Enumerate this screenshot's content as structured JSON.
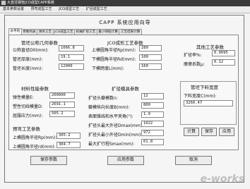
{
  "window": {
    "title": "大直径钢管JCO成型CAPP系统"
  },
  "menu": [
    "基本参数设置",
    "预弯成型工艺",
    "JCO成型工艺",
    "扩径成型工艺"
  ],
  "panel_title": "CAPP 系统应用向导",
  "tabs": [
    "水平的",
    "参数列表",
    "预弯工艺",
    "JCO成型工艺",
    "机械扩径工艺",
    "最少缺陷计算",
    "工艺结果计算"
  ],
  "nominal": {
    "heading": "管坯公称几何参数",
    "rows": [
      {
        "label": "公称直径D0(mm):",
        "value": "1066.8"
      },
      {
        "label": "管坯厚度(mm):",
        "value": "19.1"
      },
      {
        "label": "管坯长度(mm):",
        "value": "12000"
      }
    ]
  },
  "jco": {
    "heading": "JCO成形工艺参数",
    "rows": [
      {
        "label": "上模圆角半径Rp(mm):",
        "value": "280"
      },
      {
        "label": "下模圆角半径Rd(mm):",
        "value": "100"
      },
      {
        "label": "下模跨度L(mm):",
        "value": "160"
      }
    ]
  },
  "other": {
    "heading": "其他工艺参数",
    "rows": [
      {
        "label": "扩径率%:",
        "value": "0.0095"
      },
      {
        "label": "摩擦系数μ:",
        "value": "0.12"
      }
    ]
  },
  "material": {
    "heading": "材料性能参数",
    "rows": [
      {
        "label": "弹性模量E:",
        "value": "200000"
      },
      {
        "label": "塑性切线模量D:",
        "value": "2691.1"
      },
      {
        "label": "屈服应力(mm):",
        "value": "505.2"
      }
    ]
  },
  "expand": {
    "heading": "扩径模具参数",
    "rows": [
      {
        "label": "扩径头瓣模数n:",
        "value": "12"
      },
      {
        "label": "瓣模纵向长度B(mm):",
        "value": "800"
      },
      {
        "label": "表面锥线和水平夹角(°):",
        "value": "1.9"
      },
      {
        "label": "扩径头最大外径Dmax(mm):",
        "value": "1022"
      },
      {
        "label": "扩径头最小外径Dmin(mm):",
        "value": "972"
      },
      {
        "label": "最大扩行程Smax(mm):",
        "value": "61.8"
      }
    ]
  },
  "preform": {
    "heading": "预弯工艺参数",
    "rows": [
      {
        "label": "上模圆角半径Rp(mm):",
        "value": "305.2"
      },
      {
        "label": "上模圆角半径rd(mm):",
        "value": "304.7"
      }
    ]
  },
  "width": {
    "heading": "管坯下料宽度",
    "label": "下料宽度C(mm):",
    "value": "3260.47"
  },
  "buttons": {
    "calc": "计算",
    "save": "保存",
    "apply": "应用",
    "save_params": "保存参数",
    "apply_params": "应用参数",
    "cancel": "取消"
  },
  "watermark": "e-works"
}
